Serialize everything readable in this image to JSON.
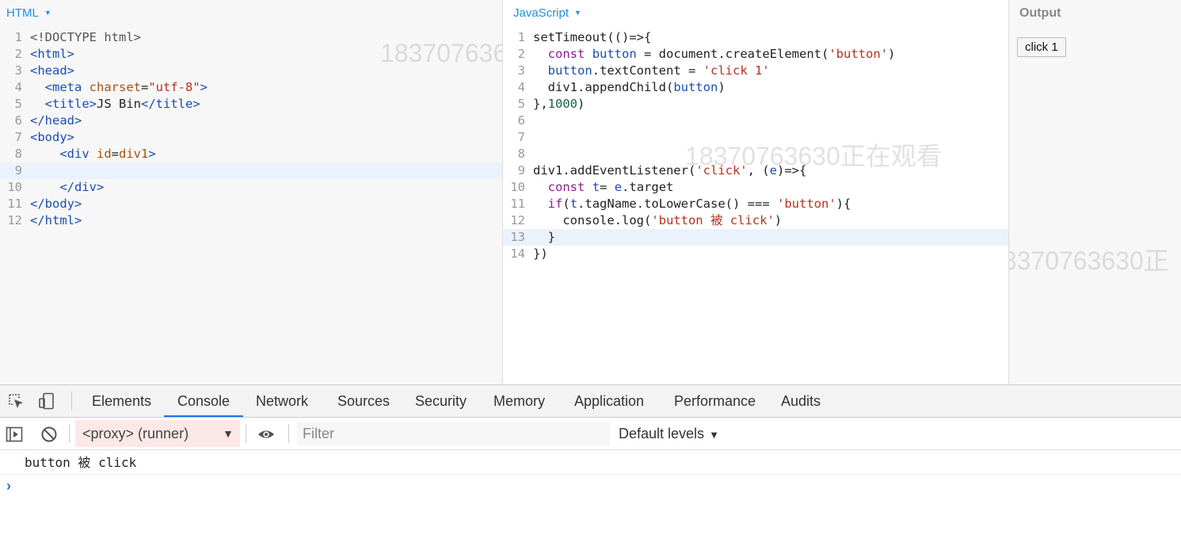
{
  "html_panel": {
    "label": "HTML",
    "lines": [
      [
        {
          "t": "<!DOCTYPE html>",
          "c": "gray"
        }
      ],
      [
        {
          "t": "<html>",
          "c": "tag"
        }
      ],
      [
        {
          "t": "<head>",
          "c": "tag"
        }
      ],
      [
        {
          "t": "  "
        },
        {
          "t": "<meta",
          "c": "tag"
        },
        {
          "t": " charset",
          "c": "attr"
        },
        {
          "t": "=",
          "c": "def"
        },
        {
          "t": "\"utf-8\"",
          "c": "str"
        },
        {
          "t": ">",
          "c": "tag"
        }
      ],
      [
        {
          "t": "  "
        },
        {
          "t": "<title>",
          "c": "tag"
        },
        {
          "t": "JS Bin",
          "c": "def"
        },
        {
          "t": "</title>",
          "c": "tag"
        }
      ],
      [
        {
          "t": "</head>",
          "c": "tag"
        }
      ],
      [
        {
          "t": "<body>",
          "c": "tag"
        }
      ],
      [
        {
          "t": "    "
        },
        {
          "t": "<div",
          "c": "tag"
        },
        {
          "t": " id",
          "c": "attr"
        },
        {
          "t": "=",
          "c": "def"
        },
        {
          "t": "div1",
          "c": "attr"
        },
        {
          "t": ">",
          "c": "tag"
        }
      ],
      [
        {
          "t": ""
        }
      ],
      [
        {
          "t": "    "
        },
        {
          "t": "</div>",
          "c": "tag"
        }
      ],
      [
        {
          "t": "</body>",
          "c": "tag"
        }
      ],
      [
        {
          "t": "</html>",
          "c": "tag"
        }
      ]
    ],
    "active_line": 9
  },
  "js_panel": {
    "label": "JavaScript",
    "lines": [
      [
        {
          "t": "setTimeout(()=>{",
          "c": "def"
        }
      ],
      [
        {
          "t": "  "
        },
        {
          "t": "const",
          "c": "kw"
        },
        {
          "t": " "
        },
        {
          "t": "button",
          "c": "var"
        },
        {
          "t": " = document.createElement(",
          "c": "def"
        },
        {
          "t": "'button'",
          "c": "str"
        },
        {
          "t": ")",
          "c": "def"
        }
      ],
      [
        {
          "t": "  "
        },
        {
          "t": "button",
          "c": "var"
        },
        {
          "t": ".textContent = ",
          "c": "def"
        },
        {
          "t": "'click 1'",
          "c": "str"
        }
      ],
      [
        {
          "t": "  div1.appendChild(",
          "c": "def"
        },
        {
          "t": "button",
          "c": "var"
        },
        {
          "t": ")",
          "c": "def"
        }
      ],
      [
        {
          "t": "},",
          "c": "def"
        },
        {
          "t": "1000",
          "c": "num"
        },
        {
          "t": ")",
          "c": "def"
        }
      ],
      [
        {
          "t": ""
        }
      ],
      [
        {
          "t": ""
        }
      ],
      [
        {
          "t": ""
        }
      ],
      [
        {
          "t": "div1.addEventListener(",
          "c": "def"
        },
        {
          "t": "'click'",
          "c": "str"
        },
        {
          "t": ", (",
          "c": "def"
        },
        {
          "t": "e",
          "c": "var"
        },
        {
          "t": ")=>{",
          "c": "def"
        }
      ],
      [
        {
          "t": "  "
        },
        {
          "t": "const",
          "c": "kw"
        },
        {
          "t": " "
        },
        {
          "t": "t",
          "c": "var"
        },
        {
          "t": "= ",
          "c": "def"
        },
        {
          "t": "e",
          "c": "var"
        },
        {
          "t": ".target",
          "c": "def"
        }
      ],
      [
        {
          "t": "  "
        },
        {
          "t": "if",
          "c": "kw"
        },
        {
          "t": "(",
          "c": "def"
        },
        {
          "t": "t",
          "c": "var"
        },
        {
          "t": ".tagName.toLowerCase() === ",
          "c": "def"
        },
        {
          "t": "'button'",
          "c": "str"
        },
        {
          "t": "){",
          "c": "def"
        }
      ],
      [
        {
          "t": "    console.log(",
          "c": "def"
        },
        {
          "t": "'button 被 click'",
          "c": "str"
        },
        {
          "t": ")",
          "c": "def"
        }
      ],
      [
        {
          "t": "  }",
          "c": "def"
        }
      ],
      [
        {
          "t": "})",
          "c": "def"
        }
      ]
    ],
    "active_line": 13
  },
  "output_panel": {
    "label": "Output",
    "button_label": "click 1"
  },
  "watermark_text": "18370763630正在观看",
  "watermark_text_partial": "18370763630正",
  "devtools": {
    "tabs": [
      "Elements",
      "Console",
      "Network",
      "Sources",
      "Security",
      "Memory",
      "Application",
      "Performance",
      "Audits"
    ],
    "active_tab": "Console",
    "context": "<proxy> (runner)",
    "filter_placeholder": "Filter",
    "levels": "Default levels",
    "messages": [
      "button 被 click"
    ],
    "prompt": "›"
  },
  "colors": {
    "link_blue": "#1e90dd",
    "active_tab_underline": "#1a73e8",
    "context_bg": "#fde8e8"
  }
}
